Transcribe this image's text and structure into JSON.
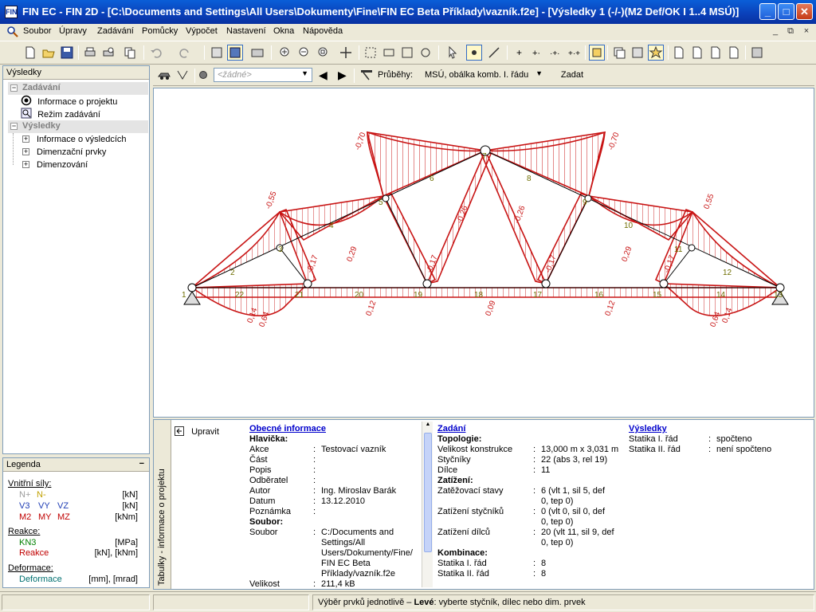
{
  "window": {
    "title": "FIN EC - FIN 2D - [C:\\Documents and Settings\\All Users\\Dokumenty\\Fine\\FIN EC Beta Příklady\\vazník.f2e] - [Výsledky 1 (-/-)(M2 Def/OK I 1..4 MSÚ)]",
    "icon": "app-icon",
    "minimize": "_",
    "maximize": "□",
    "close": "✕"
  },
  "menu": {
    "items": [
      "Soubor",
      "Úpravy",
      "Zadávání",
      "Pomůcky",
      "Výpočet",
      "Nastavení",
      "Okna",
      "Nápověda"
    ],
    "mdi": [
      "_",
      "⧉",
      "×"
    ]
  },
  "left_panel": {
    "title": "Výsledky",
    "sections": [
      {
        "label": "Zadávání",
        "items": [
          "Informace o projektu",
          "Režim zadávání"
        ]
      },
      {
        "label": "Výsledky",
        "items": [
          "Informace o výsledcích",
          "Dimenzační prvky",
          "Dimenzování"
        ]
      }
    ]
  },
  "legend": {
    "title": "Legenda",
    "collapse": "−",
    "groups": [
      {
        "title": "Vnitřní síly:",
        "rows": [
          {
            "items": [
              "N+",
              "N-"
            ],
            "unit": "[kN]"
          },
          {
            "items": [
              "V3",
              "VY",
              "VZ"
            ],
            "unit": "[kN]"
          },
          {
            "items": [
              "M2",
              "MY",
              "MZ"
            ],
            "unit": "[kNm]"
          }
        ]
      },
      {
        "title": "Reakce:",
        "rows": [
          {
            "items": [
              "KN3"
            ],
            "unit": "[MPa]"
          },
          {
            "items": [
              "Reakce"
            ],
            "unit": "[kN], [kNm]"
          }
        ]
      },
      {
        "title": "Deformace:",
        "rows": [
          {
            "items": [
              "Deformace"
            ],
            "unit": "[mm], [mrad]"
          }
        ]
      }
    ],
    "colors": {
      "n_plus": "#9C9C9C",
      "n_minus": "#C0A000",
      "v": "#1E3CB4",
      "m": "#C00000",
      "kn": "#008000",
      "reakce": "#C00000",
      "deformace": "#007070"
    }
  },
  "results_toolbar": {
    "combo_placeholder": "<žádné>",
    "prubehy_label": "Průběhy:",
    "prubehy_value": "MSÚ, obálka komb. I. řádu",
    "zadat": "Zadat"
  },
  "diagram": {
    "member_labels": [
      "1",
      "2",
      "3",
      "4",
      "5",
      "6",
      "7",
      "8",
      "9",
      "10",
      "11",
      "12",
      "13",
      "14",
      "15",
      "16",
      "17",
      "18",
      "19",
      "20",
      "21",
      "22"
    ],
    "values": {
      "top_left_outer": "-0,70",
      "top_right_outer": "-0,70",
      "mid_left": "-0,55",
      "mid_right": "0,55",
      "diag_left_a": "0,29",
      "diag_left_b": "-0,26",
      "diag_right_a": "-0,26",
      "diag_right_b": "0,29",
      "v1": "-0,17",
      "v2": "-0,17",
      "v3": "-0,17",
      "v4": "-0,17",
      "bot1": "0,12",
      "bot2": "0,09",
      "bot3": "0,12",
      "end_left_a": "0,14",
      "end_left_b": "0,64",
      "end_right_a": "0,64",
      "end_right_b": "0,14"
    },
    "colors": {
      "moment": "#C81414",
      "member": "#000000",
      "label": "#6E6E00"
    }
  },
  "bottom_panel": {
    "vertical_tab": "Tabulky - informace o projektu",
    "upravit": "Upravit",
    "obecne": {
      "title": "Obecné informace",
      "hlavicka": "Hlavička:",
      "rows": [
        {
          "k": "Akce",
          "v": "Testovací vazník"
        },
        {
          "k": "Část",
          "v": ""
        },
        {
          "k": "Popis",
          "v": ""
        },
        {
          "k": "Odběratel",
          "v": ""
        },
        {
          "k": "Autor",
          "v": "Ing. Miroslav Barák"
        },
        {
          "k": "Datum",
          "v": "13.12.2010"
        },
        {
          "k": "Poznámka",
          "v": ""
        }
      ],
      "soubor_h": "Soubor:",
      "soubor_k": "Soubor",
      "soubor_lines": [
        "C:/Documents and",
        "Settings/All",
        "Users/Dokumenty/Fine/",
        "FIN EC Beta",
        "Příklady/vazník.f2e"
      ],
      "velikost_k": "Velikost",
      "velikost_v": "211,4 kB"
    },
    "zadani": {
      "title": "Zadání",
      "topologie": "Topologie:",
      "rows": [
        {
          "k": "Velikost konstrukce",
          "v": "13,000 m x 3,031 m"
        },
        {
          "k": "Styčníky",
          "v": "22 (abs 3, rel 19)"
        },
        {
          "k": "Dílce",
          "v": "11"
        }
      ],
      "zatizeni": "Zatížení:",
      "zat_rows": [
        {
          "k": "Zatěžovací stavy",
          "v1": "6 (vlt 1, sil 5, def",
          "v2": "0, tep 0)"
        },
        {
          "k": "Zatížení styčníků",
          "v1": "0 (vlt 0, sil 0, def",
          "v2": "0, tep 0)"
        },
        {
          "k": "Zatížení dílců",
          "v1": "20 (vlt 11, sil 9, def",
          "v2": "0, tep 0)"
        }
      ],
      "kombinace": "Kombinace:",
      "komb_rows": [
        {
          "k": "Statika I. řád",
          "v": "8"
        },
        {
          "k": "Statika II. řád",
          "v": "8"
        }
      ]
    },
    "vysledky": {
      "title": "Výsledky",
      "rows": [
        {
          "k": "Statika I. řád",
          "v": "spočteno"
        },
        {
          "k": "Statika II. řád",
          "v": "není spočteno"
        }
      ]
    }
  },
  "status": {
    "prefix": "Výběr prvků jednotlivě – ",
    "bold": "Levé",
    "suffix": ": vyberte styčník, dílec nebo dim. prvek"
  }
}
